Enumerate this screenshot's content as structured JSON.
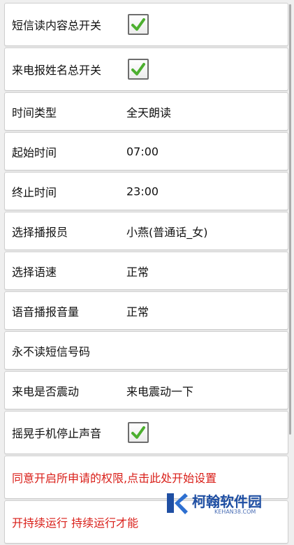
{
  "settings": {
    "sms_read_switch": {
      "label": "短信读内容总开关",
      "checked": true
    },
    "call_name_switch": {
      "label": "来电报姓名总开关",
      "checked": true
    },
    "time_type": {
      "label": "时间类型",
      "value": "全天朗读"
    },
    "start_time": {
      "label": "起始时间",
      "value": "07:00"
    },
    "end_time": {
      "label": "终止时间",
      "value": "23:00"
    },
    "announcer": {
      "label": "选择播报员",
      "value": "小燕(普通话_女)"
    },
    "speech_rate": {
      "label": "选择语速",
      "value": "正常"
    },
    "volume": {
      "label": "语音播报音量",
      "value": "正常"
    },
    "blocked_numbers": {
      "label": "永不读短信号码"
    },
    "call_vibrate": {
      "label": "来电是否震动",
      "value": "来电震动一下"
    },
    "shake_stop": {
      "label": "摇晃手机停止声音",
      "checked": true
    },
    "permission_notice": {
      "label": "同意开启所申请的权限,点击此处开始设置"
    },
    "background_notice": {
      "label": "开持续运行 持续运行才能"
    }
  },
  "watermark": {
    "title": "柯翰软件园",
    "url": "KEHAN38.COM"
  },
  "colors": {
    "check_green": "#4caf2f",
    "warning_red": "#d91e18",
    "watermark_blue": "#1f4fa3"
  }
}
